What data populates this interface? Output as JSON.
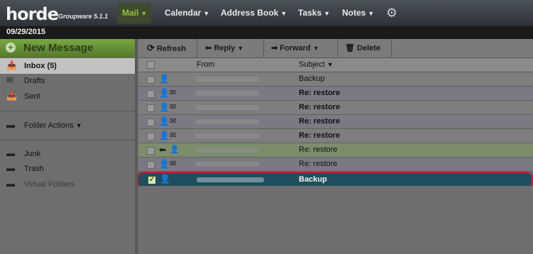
{
  "app": {
    "logo": "horde",
    "version": "Groupware 5.1.1"
  },
  "nav": {
    "mail": "Mail",
    "calendar": "Calendar",
    "address_book": "Address Book",
    "tasks": "Tasks",
    "notes": "Notes"
  },
  "date": "09/29/2015",
  "sidebar": {
    "new_message": "New Message",
    "folders": [
      {
        "label": "Inbox (5)",
        "icon": "inbox-icon"
      },
      {
        "label": "Drafts",
        "icon": "drafts-icon"
      },
      {
        "label": "Sent",
        "icon": "sent-icon"
      }
    ],
    "folder_actions": "Folder Actions",
    "other_folders": [
      {
        "label": "Junk",
        "icon": "folder-icon"
      },
      {
        "label": "Trash",
        "icon": "folder-icon"
      },
      {
        "label": "Virtual Folders",
        "icon": "virtual-folder-icon"
      }
    ]
  },
  "toolbar": {
    "refresh": "Refresh",
    "reply": "Reply",
    "forward": "Forward",
    "delete": "Delete"
  },
  "list": {
    "col_from": "From",
    "col_subject": "Subject",
    "rows": [
      {
        "subject": "Backup"
      },
      {
        "subject": "Re: restore"
      },
      {
        "subject": "Re: restore"
      },
      {
        "subject": "Re: restore"
      },
      {
        "subject": "Re: restore"
      },
      {
        "subject": "Re: restore"
      },
      {
        "subject": "Re: restore"
      },
      {
        "subject": "Backup"
      }
    ]
  },
  "colors": {
    "accent_green": "#8fc03a",
    "selected_row": "#1f4f5e",
    "highlight_outline": "#c42131"
  }
}
